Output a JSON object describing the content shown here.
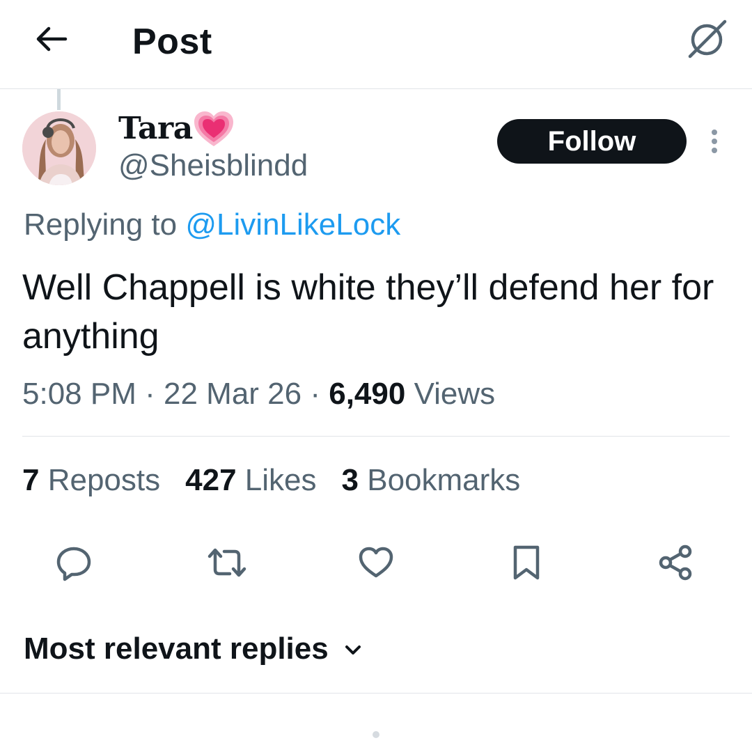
{
  "header": {
    "title": "Post",
    "back_icon": "arrow-left-icon",
    "grok_icon": "grok-icon"
  },
  "author": {
    "display_name": "Tara",
    "name_emoji": "growing-heart-emoji",
    "handle": "@Sheisblindd",
    "follow_label": "Follow"
  },
  "reply_context": {
    "prefix": "Replying to",
    "mention": "@LivinLikeLock"
  },
  "tweet": {
    "text": "Well Chappell is white they’ll defend her for anything"
  },
  "meta": {
    "time": "5:08 PM",
    "date": "22 Mar 26",
    "views_count": "6,490",
    "views_label": "Views",
    "separator": "·"
  },
  "stats": {
    "reposts_count": "7",
    "reposts_label": "Reposts",
    "likes_count": "427",
    "likes_label": "Likes",
    "bookmarks_count": "3",
    "bookmarks_label": "Bookmarks"
  },
  "actions": [
    "reply-icon",
    "repost-icon",
    "like-icon",
    "bookmark-icon",
    "share-icon"
  ],
  "replies": {
    "sort_label": "Most relevant replies"
  },
  "colors": {
    "text": "#0f1419",
    "secondary": "#536471",
    "link": "#1d9bf0",
    "follow_bg": "#0f1419",
    "divider": "#e1e4e8"
  }
}
